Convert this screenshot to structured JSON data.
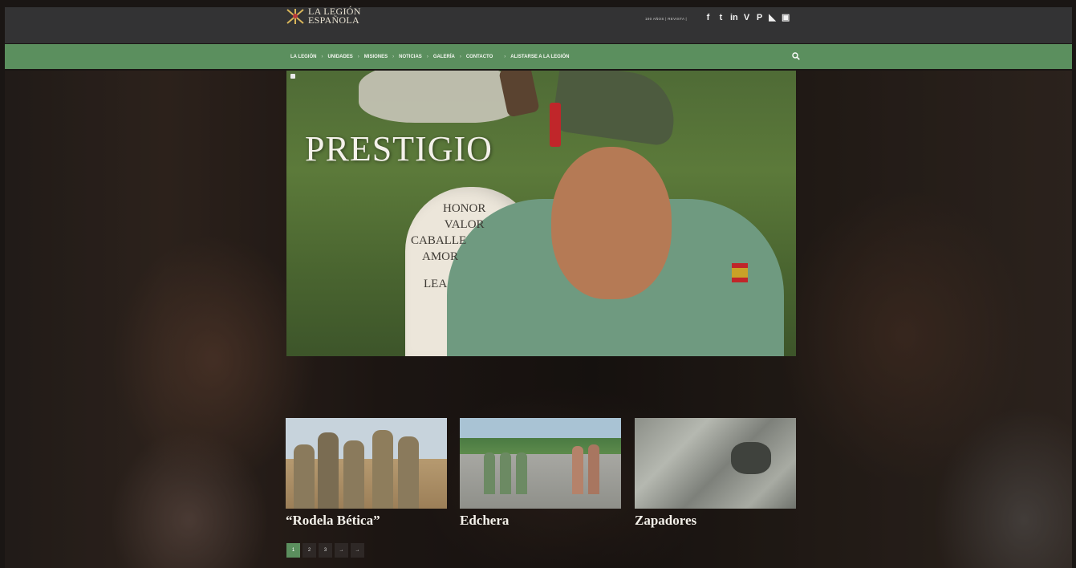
{
  "header": {
    "logo_line1": "LA LEGIÓN",
    "logo_line2": "ESPAÑOLA",
    "top_links": "100 AÑOS | REVISTA |",
    "social": [
      {
        "name": "facebook-icon",
        "glyph": "f"
      },
      {
        "name": "twitter-icon",
        "glyph": "t"
      },
      {
        "name": "linkedin-icon",
        "glyph": "in"
      },
      {
        "name": "vimeo-icon",
        "glyph": "V"
      },
      {
        "name": "pinterest-icon",
        "glyph": "P"
      },
      {
        "name": "rss-icon",
        "glyph": "◣"
      },
      {
        "name": "instagram-icon",
        "glyph": "▣"
      }
    ]
  },
  "nav": {
    "items": [
      "LA LEGIÓN",
      "UNIDADES",
      "MISIONES",
      "NOTICIAS",
      "GALERÍA",
      "CONTACTO",
      "ALISTARSE A LA LEGIÓN"
    ],
    "search_icon": "search-icon"
  },
  "hero": {
    "title": "PRESTIGIO",
    "stone_text": [
      "HONOR",
      "VALOR",
      "CABALLE",
      "AMOR",
      "LEA"
    ]
  },
  "cards": [
    {
      "title": "“Rodela Bética”"
    },
    {
      "title": "Edchera"
    },
    {
      "title": "Zapadores"
    }
  ],
  "pagination": {
    "pages": [
      "1",
      "2",
      "3",
      "→",
      "→"
    ],
    "active": "1"
  },
  "colors": {
    "topbar": "#333334",
    "navbar": "#5b8f5e",
    "accent": "#5b8f5e"
  }
}
